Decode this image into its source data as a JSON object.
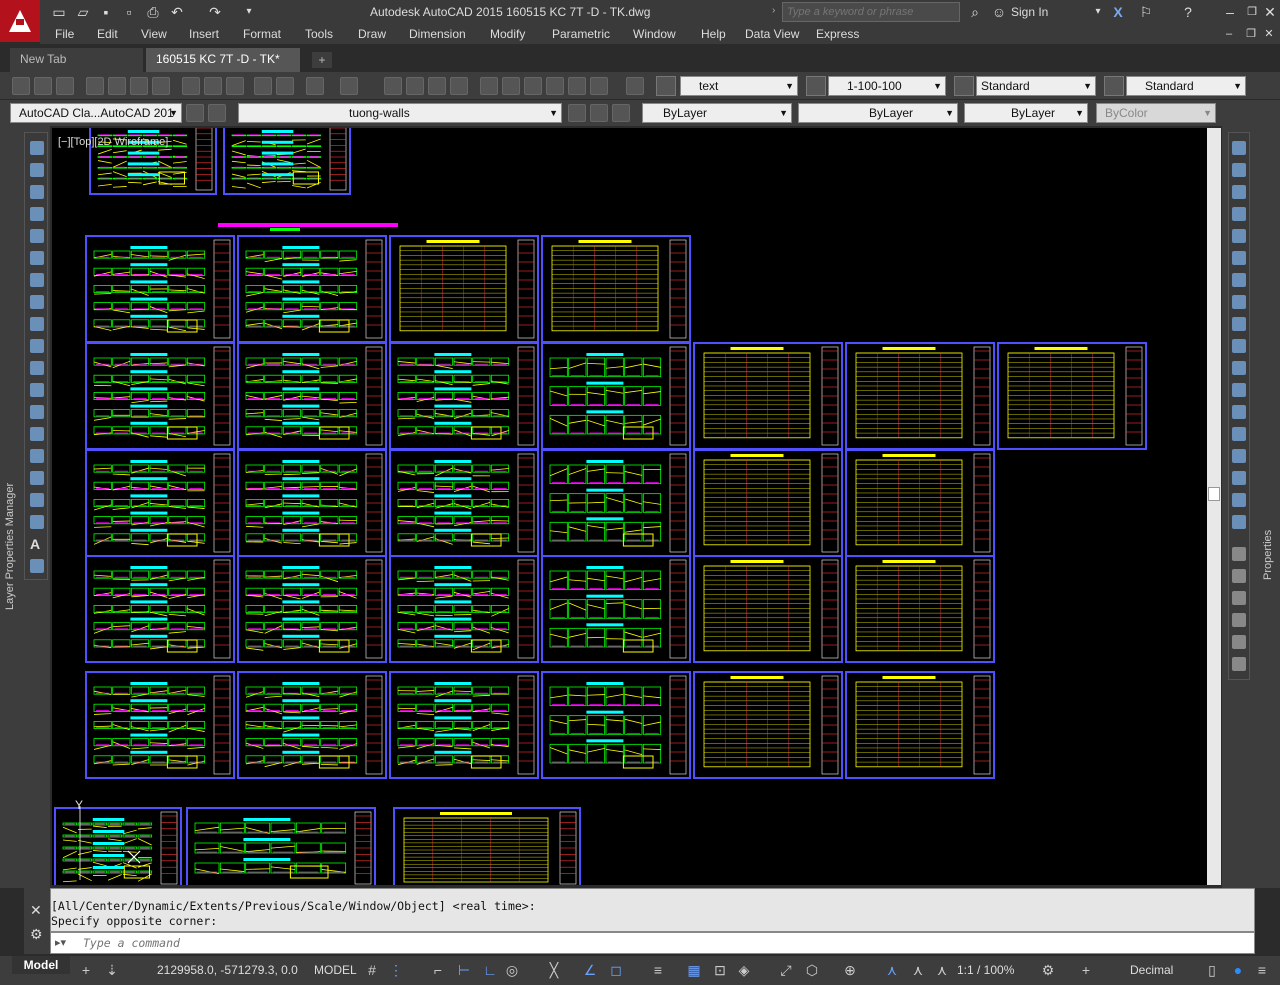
{
  "app": {
    "window_title": "Autodesk AutoCAD 2015   160515 KC 7T -D -  TK.dwg",
    "search_placeholder": "Type a keyword or phrase",
    "sign_in": "Sign In"
  },
  "menu": [
    "File",
    "Edit",
    "View",
    "Insert",
    "Format",
    "Tools",
    "Draw",
    "Dimension",
    "Modify",
    "Parametric",
    "Window",
    "Help",
    "Data View",
    "Express"
  ],
  "tabs": [
    {
      "label": "New Tab"
    },
    {
      "label": "160515 KC 7T -D -  TK*"
    }
  ],
  "toolbar": {
    "text_style": "text",
    "dim_style": "1-100-100",
    "table_style": "Standard",
    "mleader_style": "Standard",
    "workspace": "AutoCAD Cla...AutoCAD 201",
    "layer": "tuong-walls",
    "color": "ByLayer",
    "linetype": "ByLayer",
    "lineweight": "ByLayer",
    "plotstyle": "ByColor"
  },
  "viewport": {
    "label": "[−][Top][2D Wireframe]"
  },
  "panels": {
    "left_title": "Layer Properties Manager",
    "right_title": "Properties"
  },
  "command": {
    "history": [
      "[All/Center/Dynamic/Extents/Previous/Scale/Window/Object] <real time>:",
      "Specify opposite corner:"
    ],
    "placeholder": "Type a command"
  },
  "status": {
    "layout_tab": "Model",
    "coordinates": "2129958.0, -571279.3, 0.0",
    "space": "MODEL",
    "annotation_scale": "1:1 / 100%",
    "units": "Decimal"
  },
  "colors": {
    "canvas": "#000000",
    "sheet_border": "#5050ff",
    "drawing_yellow": "#ffff00",
    "drawing_green": "#00ff00",
    "drawing_cyan": "#00ffff",
    "drawing_magenta": "#ff00ff",
    "logo_red": "#b3121c"
  }
}
